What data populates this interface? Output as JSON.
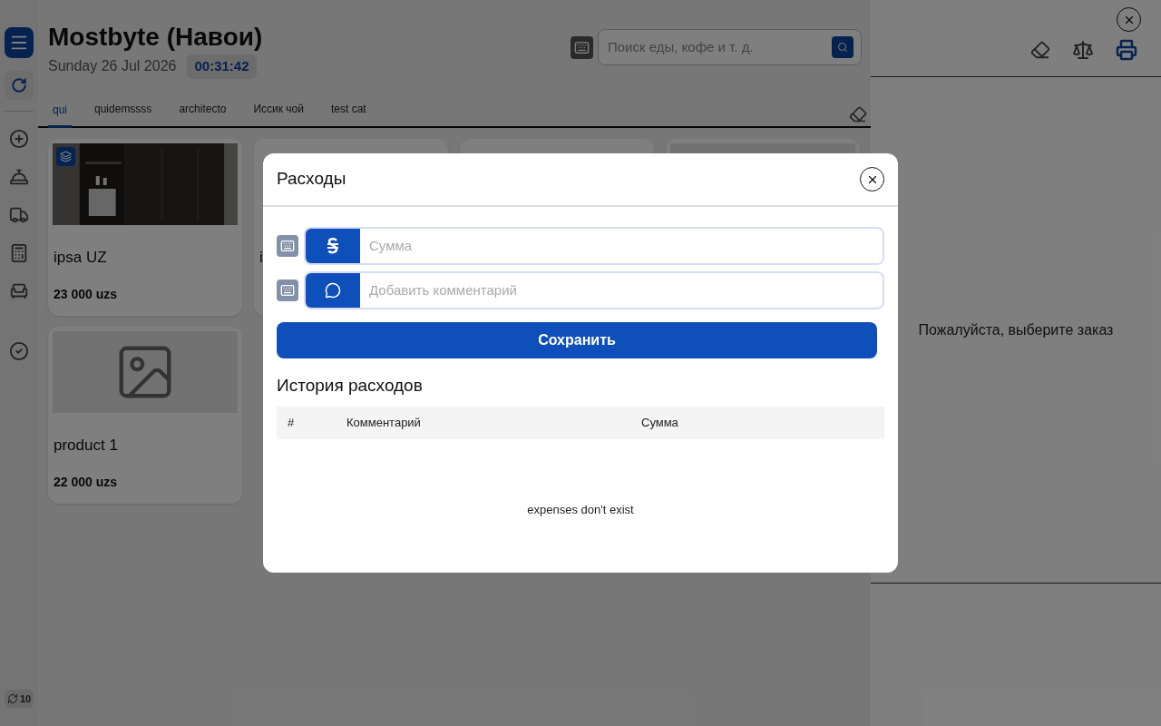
{
  "sidebar": {
    "sync_count": "10"
  },
  "header": {
    "title": "Mostbyte (Навои)",
    "date": "Sunday 26 Jul 2026",
    "time": "00:31:42"
  },
  "search": {
    "placeholder": "Поиск еды, кофе и т. д."
  },
  "tabs": [
    {
      "label": "qui",
      "selected": true
    },
    {
      "label": "quidemssss",
      "selected": false
    },
    {
      "label": "architecto",
      "selected": false
    },
    {
      "label": "Иссик чой",
      "selected": false
    },
    {
      "label": "test cat",
      "selected": false
    }
  ],
  "products": [
    {
      "badge": true,
      "name": "ipsa UZ",
      "price": "23 000 uzs"
    },
    {
      "kind": "plain",
      "badge": false,
      "name": "i"
    },
    {
      "kind": "plain",
      "badge": false
    },
    {
      "kind": "gray",
      "badge": false
    },
    {
      "kind": "placeholder",
      "badge": false,
      "name": "product 1",
      "price": "22 000 uzs"
    }
  ],
  "order_panel": {
    "message": "Пожалуйста, выберите заказ"
  },
  "modal": {
    "title": "Расходы",
    "fields": [
      {
        "kind": "amount",
        "placeholder": "Сумма"
      },
      {
        "kind": "comment",
        "placeholder": "Добавить комментарий"
      }
    ],
    "save_button": "Сохранить",
    "history_title": "История расходов",
    "columns": [
      "#",
      "Комментарий",
      "Сумма"
    ],
    "empty_message": "expenses don't exist"
  }
}
